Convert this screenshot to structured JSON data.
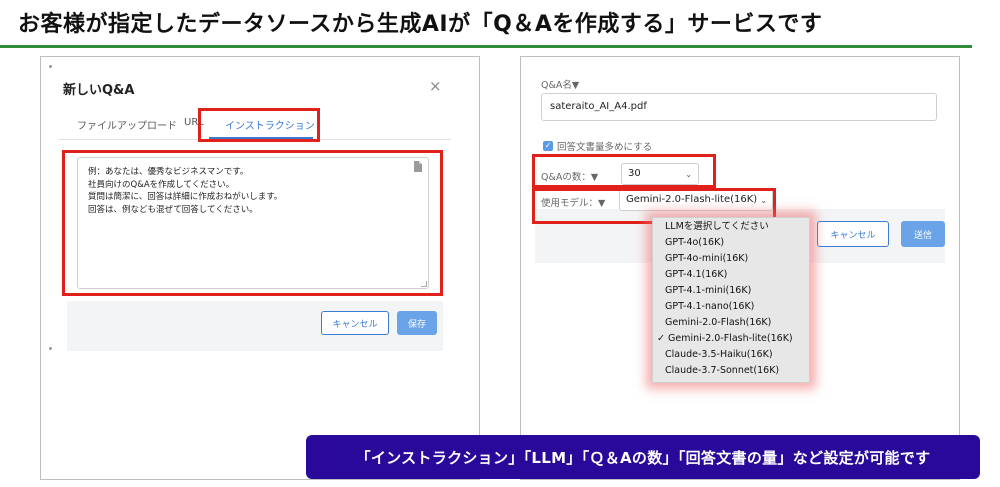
{
  "headline": "お客様が指定したデータソースから生成AIが「Q＆Aを作成する」サービスです",
  "left_dialog": {
    "title": "新しいQ&A",
    "close_symbol": "×",
    "tabs": [
      {
        "label": "ファイルアップロード",
        "active": false
      },
      {
        "label": "URL",
        "active": false
      },
      {
        "label": "インストラクション",
        "active": true
      }
    ],
    "instruction_lines": [
      "例：あなたは、優秀なビジネスマンです。",
      "社員向けのQ&Aを作成してください。",
      "質問は簡潔に、回答は詳細に作成おねがいします。",
      "回答は、例なども混ぜて回答してください。"
    ],
    "cancel_label": "キャンセル",
    "save_label": "保存"
  },
  "right_dialog": {
    "name_label": "Q&A名▼",
    "name_value": "sateraito_AI_A4.pdf",
    "checkbox_label": "回答文書量多めにする",
    "checkbox_checked": true,
    "count_label": "Q&Aの数：▼",
    "count_value": "30",
    "model_label": "使用モデル：▼",
    "model_value": "Gemini-2.0-Flash-lite(16K)",
    "cancel_label": "キャンセル",
    "send_label": "送信",
    "model_options": [
      "LLMを選択してください",
      "GPT-4o(16K)",
      "GPT-4o-mini(16K)",
      "GPT-4.1(16K)",
      "GPT-4.1-mini(16K)",
      "GPT-4.1-nano(16K)",
      "Gemini-2.0-Flash(16K)",
      "Gemini-2.0-Flash-lite(16K)",
      "Claude-3.5-Haiku(16K)",
      "Claude-3.7-Sonnet(16K)"
    ],
    "selected_option": "Gemini-2.0-Flash-lite(16K)",
    "check_mark": "✓"
  },
  "banner": "「インストラクション」「LLM」「Ｑ＆Aの数」「回答文書の量」など設定が可能です",
  "colors": {
    "accent_green": "#2e8b3a",
    "highlight_red": "#e0201b",
    "primary_blue": "#3a7bd5",
    "banner_bg": "#29099a"
  }
}
